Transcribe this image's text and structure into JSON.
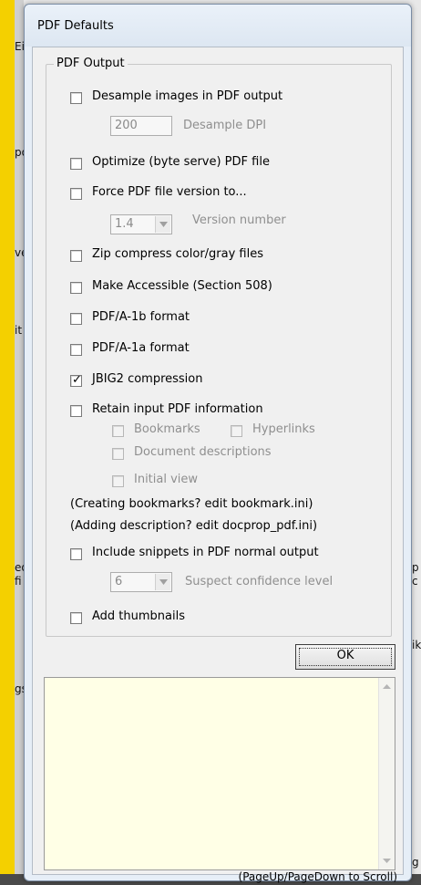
{
  "window": {
    "title": "PDF Defaults"
  },
  "background_fragments": [
    "Ei",
    "po",
    "ve",
    "it",
    "ed",
    "fi",
    "p",
    "c",
    "ik",
    "gs",
    "g"
  ],
  "pdf_output": {
    "group_label": "PDF Output",
    "options": {
      "desample": {
        "label": "Desample images in PDF output",
        "checked": false
      },
      "desample_dpi": {
        "value": "200",
        "label": "Desample DPI"
      },
      "optimize": {
        "label": "Optimize (byte serve) PDF file",
        "checked": false
      },
      "force_version": {
        "label": "Force PDF file version to...",
        "checked": false
      },
      "version_number": {
        "value": "1.4",
        "label": "Version number"
      },
      "zip_compress": {
        "label": "Zip compress color/gray files",
        "checked": false
      },
      "accessible": {
        "label": "Make Accessible (Section 508)",
        "checked": false
      },
      "pdfa_1b": {
        "label": "PDF/A-1b format",
        "checked": false
      },
      "pdfa_1a": {
        "label": "PDF/A-1a format",
        "checked": false
      },
      "jbig2": {
        "label": "JBIG2 compression",
        "checked": true,
        "mark": "✓"
      },
      "retain_info": {
        "label": "Retain input PDF information",
        "checked": false
      },
      "bookmarks": {
        "label": "Bookmarks",
        "checked": false
      },
      "hyperlinks": {
        "label": "Hyperlinks",
        "checked": false
      },
      "doc_descriptions": {
        "label": "Document descriptions",
        "checked": false
      },
      "initial_view": {
        "label": "Initial view",
        "checked": false
      },
      "snippets": {
        "label": "Include snippets in PDF normal output",
        "checked": false
      },
      "confidence": {
        "value": "6",
        "label": "Suspect confidence level"
      },
      "thumbnails": {
        "label": "Add thumbnails",
        "checked": false
      }
    },
    "notes": {
      "bookmarks_note": "(Creating bookmarks? edit bookmark.ini)",
      "description_note": "(Adding description? edit docprop_pdf.ini)"
    }
  },
  "ok_button": {
    "label": "OK"
  },
  "memo": {
    "scroll_hint": "(PageUp/PageDown to Scroll)",
    "background": "#ffffe6"
  },
  "colors": {
    "page_background": "#f4d000",
    "dialog_frame": "#e6eef7"
  }
}
